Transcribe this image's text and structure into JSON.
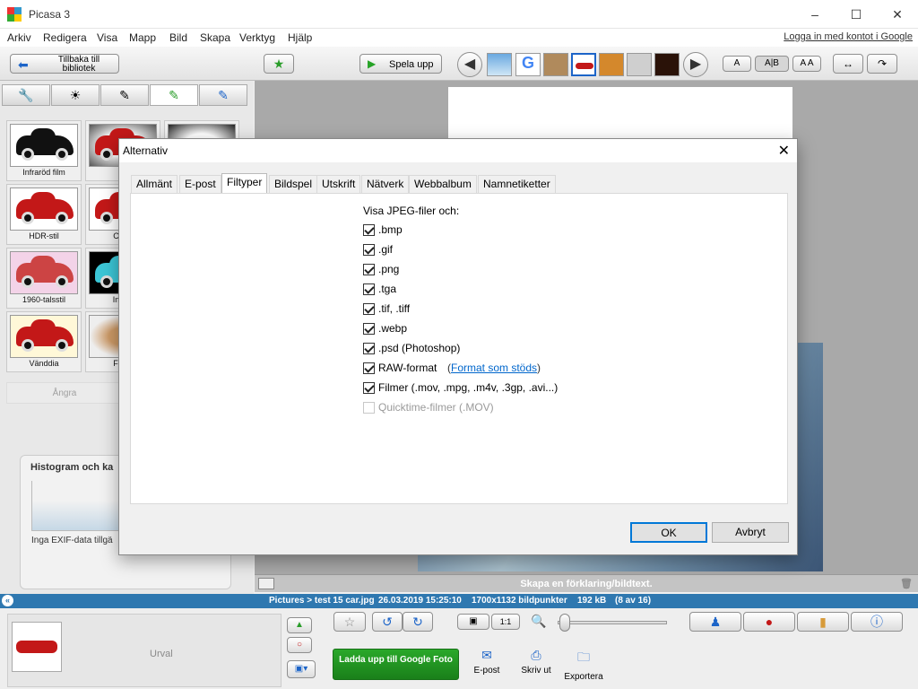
{
  "window": {
    "title": "Picasa 3",
    "login_link": "Logga in med kontot i Google"
  },
  "menu": [
    "Arkiv",
    "Redigera",
    "Visa",
    "Mapp",
    "Bild",
    "Skapa",
    "Verktyg",
    "Hjälp"
  ],
  "toolbar": {
    "back_label": "Tillbaka till bibliotek",
    "play_label": "Spela upp",
    "font_small": "A",
    "font_medium": "A|B",
    "font_large": "A A"
  },
  "effects": [
    {
      "label": "Infraröd film"
    },
    {
      "label": "Lo"
    },
    {
      "label": ""
    },
    {
      "label": "HDR-stil"
    },
    {
      "label": "Ciner"
    },
    {
      "label": "1960-talsstil"
    },
    {
      "label": "Invert"
    },
    {
      "label": "Vänddia"
    },
    {
      "label": "Färgr"
    }
  ],
  "undo_label": "Ångra",
  "histogram": {
    "title": "Histogram och ka",
    "exif": "Inga EXIF-data tillgä"
  },
  "caption_placeholder": "Skapa en förklaring/bildtext.",
  "status": {
    "path": "Pictures > test 15 car.jpg",
    "date": "26.03.2019 15:25:10",
    "dims": "1700x1132 bildpunkter",
    "size": "192 kB",
    "count": "(8 av 16)"
  },
  "bottom": {
    "selection_label": "Urval",
    "upload_label": "Ladda upp till Google Foto",
    "email_label": "E-post",
    "print_label": "Skriv ut",
    "export_label": "Exportera"
  },
  "dialog": {
    "title": "Alternativ",
    "tabs": [
      "Allmänt",
      "E-post",
      "Filtyper",
      "Bildspel",
      "Utskrift",
      "Nätverk",
      "Webbalbum",
      "Namnetiketter"
    ],
    "selected_tab": "Filtyper",
    "heading": "Visa JPEG-filer och:",
    "options": [
      {
        "label": ".bmp",
        "checked": true
      },
      {
        "label": ".gif",
        "checked": true
      },
      {
        "label": ".png",
        "checked": true
      },
      {
        "label": ".tga",
        "checked": true
      },
      {
        "label": ".tif, .tiff",
        "checked": true
      },
      {
        "label": ".webp",
        "checked": true
      },
      {
        "label": ".psd (Photoshop)",
        "checked": true
      },
      {
        "label": "RAW-format",
        "checked": true,
        "link": "Format som stöds"
      },
      {
        "label": "Filmer (.mov, .mpg, .m4v, .3gp, .avi...)",
        "checked": true
      },
      {
        "label": "Quicktime-filmer (.MOV)",
        "checked": false,
        "disabled": true
      }
    ],
    "ok_label": "OK",
    "cancel_label": "Avbryt"
  },
  "colors": {
    "accent": "#2f78b0",
    "link": "#0066cc",
    "upload_green": "#1f8f1f"
  }
}
